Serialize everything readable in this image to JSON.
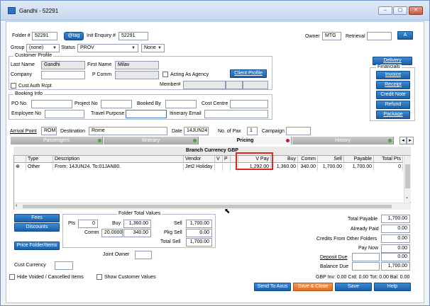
{
  "window": {
    "title": "Gandhi - 52291",
    "min": "‒",
    "max": "▢",
    "close": "✕"
  },
  "header": {
    "folder_label": "Folder #",
    "folder_value": "52291",
    "tag_btn": "@tag",
    "enquiry_label": "Init Enquiry #",
    "enquiry_value": "52291",
    "owner_label": "Owner",
    "owner_value": "MTG",
    "retrieval_label": "Retrieval",
    "retrieval_value": "",
    "a_btn": "A",
    "group_label": "Group",
    "group_value": "(none)",
    "status_label": "Status",
    "status_value": "PROV",
    "none_value": "None"
  },
  "customer": {
    "legend": "Customer Profile",
    "lastname_label": "Last Name",
    "lastname": "Gandhi",
    "firstname_label": "First Name",
    "firstname": "Milav",
    "company_label": "Company",
    "company": "",
    "pcomm_label": "P Comm",
    "pcomm": "",
    "acting_label": "Acting As Agency",
    "client_profile_btn": "Client Profile",
    "cust_auth_label": "Cust Auth Rcpt",
    "member_label": "Member#"
  },
  "side": {
    "delivery": "Delivery",
    "financials": "Financials",
    "invoice": "Invoice",
    "receipt": "Receipt",
    "credit_note": "Credit Note",
    "refund": "Refund",
    "package": "Package"
  },
  "booking": {
    "legend": "Booking Info",
    "po_label": "PO No.",
    "project_label": "Project No",
    "booked_label": "Booked By",
    "cost_label": "Cost Centre",
    "employee_label": "Employee No",
    "purpose_label": "Travel Purpose",
    "itin_label": "Itinerary Email"
  },
  "trip": {
    "arrival_label": "Arrival Point",
    "arrival": "ROM",
    "dest_label": "Destination",
    "dest": "Rome",
    "date_label": "Date",
    "date": "14JUN24",
    "pax_label": "No. of Pax",
    "pax": "1",
    "campaign_label": "Campaign",
    "campaign": ""
  },
  "tabs": [
    {
      "label": "Passengers"
    },
    {
      "label": "Itinerary"
    },
    {
      "label": "Pricing"
    },
    {
      "label": "History"
    }
  ],
  "colors": {
    "green": "#3fae29",
    "red": "#c8172c",
    "accent": "#1b5fa8"
  },
  "pricing": {
    "title": "Branch Currency GBP",
    "headers": [
      "",
      "Type",
      "Description",
      "Vendor",
      "V",
      "P",
      "",
      "V Pay",
      "Buy",
      "Comm",
      "Sell",
      "Payable",
      "Total Pts"
    ],
    "row": [
      "⊕",
      "Other",
      "From: 14JUN24. To:01JAN80.",
      "Jet2 Holiday",
      "",
      "",
      "",
      "1,292.00",
      "1,360.00",
      "340.00",
      "1,700.00",
      "1,700.00",
      "0"
    ]
  },
  "buttons": {
    "fees": "Fees",
    "discounts": "Discounts",
    "price_folder": "Price Folder/Items",
    "send_to_axus": "Send To Axus",
    "save_close": "Save & Close",
    "save": "Save",
    "help": "Help"
  },
  "totals": {
    "legend": "Folder Total Values",
    "pts_label": "Pts",
    "pts": "0",
    "buy_label": "Buy",
    "buy": "1,360.00",
    "sell_label": "Sell",
    "sell": "1,700.00",
    "comm_label": "Comm",
    "comm_pct": "20.0000",
    "comm": "340.00",
    "pkg_label": "Pkg Sell",
    "pkg": "0.00",
    "total_label": "Total Sell",
    "total": "1,700.00"
  },
  "bottom": {
    "joint_owner_label": "Joint Owner",
    "cust_currency_label": "Cust Currency",
    "hide_voided_label": "Hide Voided / Cancelled Items",
    "show_customer_label": "Show Customer Values"
  },
  "summary": {
    "total_payable_label": "Total Payable",
    "total_payable": "1,700.00",
    "already_paid_label": "Already Paid",
    "already_paid": "0.00",
    "credits_label": "Credits From Other Folders",
    "credits": "0.00",
    "pay_now_label": "Pay Now",
    "pay_now": "0.00",
    "deposit_label": "Deposit Due",
    "deposit": "0.00",
    "balance_label": "Balance Due",
    "balance": "1,700.00",
    "footer": "GBP  Inv: 0.00  Crd: 0.00  Tot: 0.00  Bal: 0.00"
  }
}
